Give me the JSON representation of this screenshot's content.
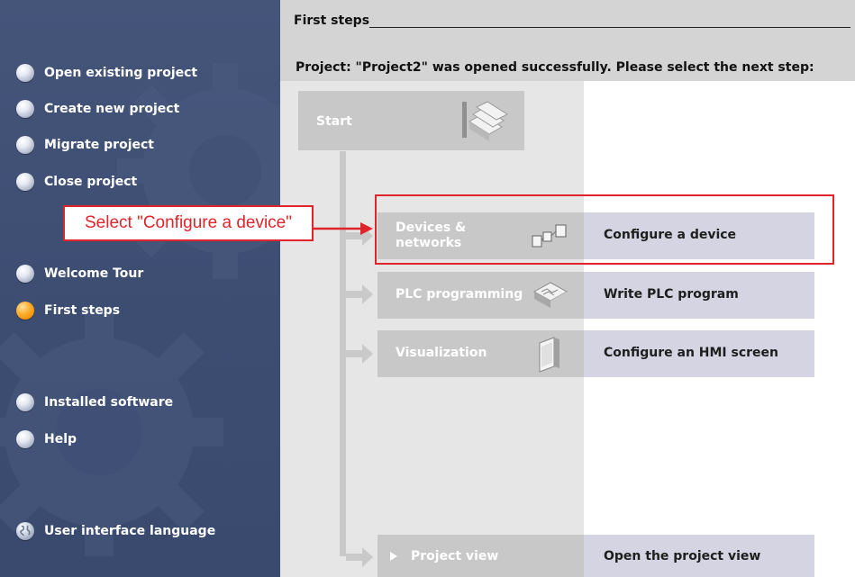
{
  "sidebar": {
    "items": [
      {
        "label": "Open existing project",
        "icon": "bullet-icon"
      },
      {
        "label": "Create new project",
        "icon": "bullet-icon"
      },
      {
        "label": "Migrate project",
        "icon": "bullet-icon"
      },
      {
        "label": "Close project",
        "icon": "bullet-icon"
      },
      {
        "label": "Welcome Tour",
        "icon": "bullet-icon"
      },
      {
        "label": "First steps",
        "icon": "bullet-active-icon",
        "active": true
      },
      {
        "label": "Installed software",
        "icon": "bullet-icon"
      },
      {
        "label": "Help",
        "icon": "bullet-icon"
      },
      {
        "label": "User interface language",
        "icon": "globe-icon"
      }
    ]
  },
  "main": {
    "section_title": "First steps",
    "status_message": "Project: \"Project2\" was opened successfully. Please select the next step:",
    "start": {
      "label": "Start",
      "icon": "stairs-icon"
    },
    "steps": [
      {
        "left_label": "Devices &\nnetworks",
        "right_label": "Configure a device",
        "icon": "network-devices-icon"
      },
      {
        "left_label": "PLC programming",
        "right_label": "Write PLC program",
        "icon": "plc-chip-icon"
      },
      {
        "left_label": "Visualization",
        "right_label": "Configure an HMI screen",
        "icon": "hmi-panel-icon"
      },
      {
        "left_label": "Project view",
        "right_label": "Open the project view",
        "icon": "play-triangle-icon"
      }
    ]
  },
  "annotation": {
    "callout_text": "Select \"Configure a device\"",
    "color": "#e0242b"
  },
  "colors": {
    "sidebar_bg": "#3d4d72",
    "active_bullet": "#f08f00",
    "step_box": "#c8c8c8",
    "step_action": "#d4d4e2"
  }
}
